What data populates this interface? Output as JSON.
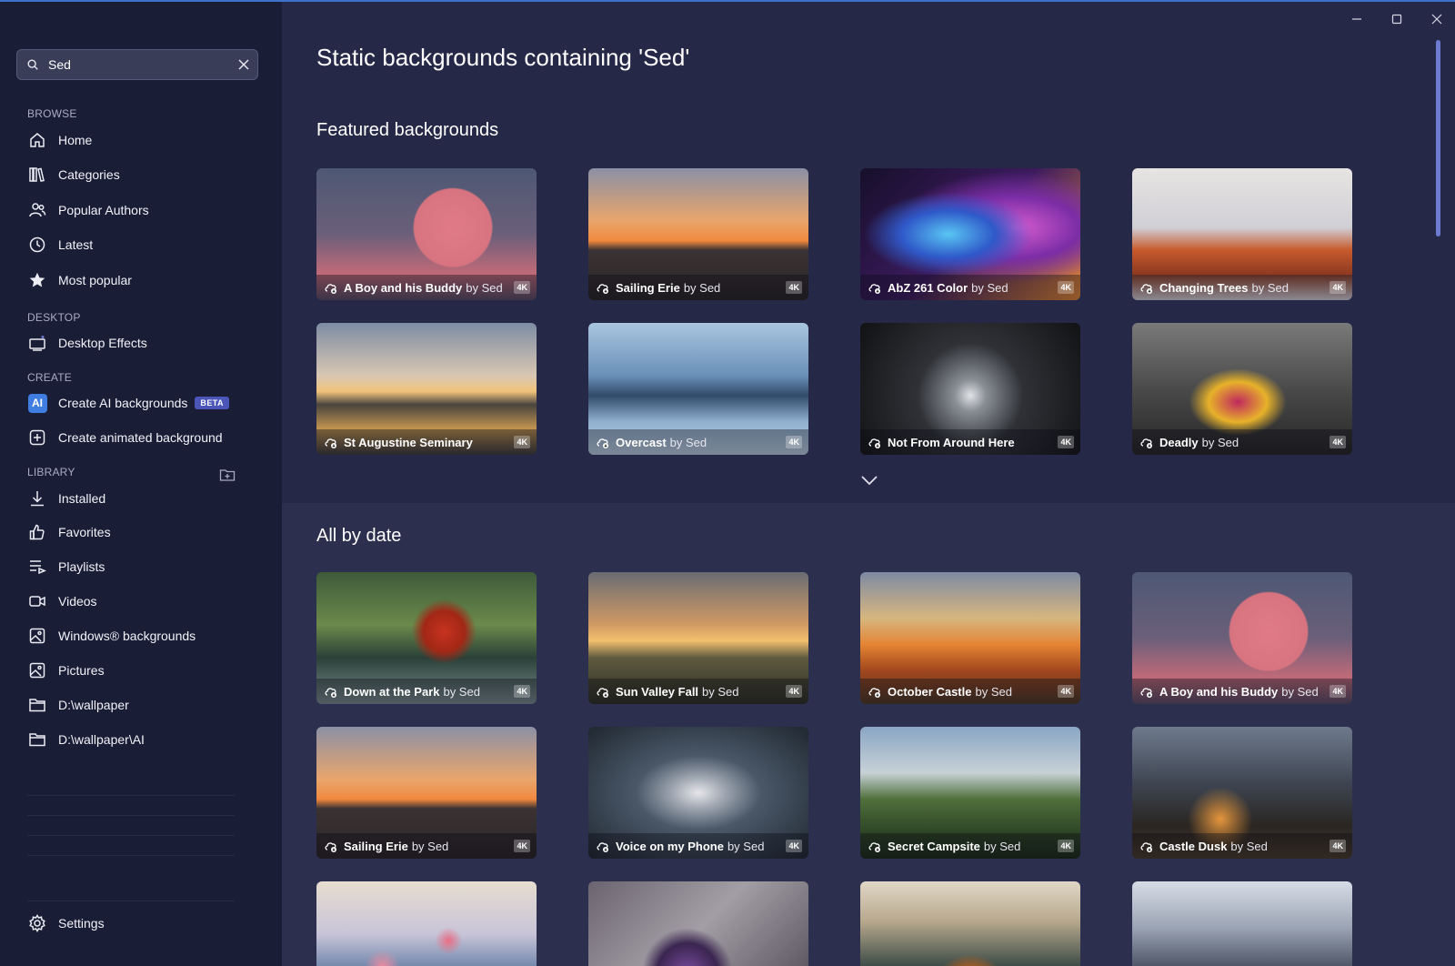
{
  "search": {
    "value": "Sed",
    "placeholder": ""
  },
  "sidebar": {
    "sections": {
      "browse": "BROWSE",
      "desktop": "DESKTOP",
      "create": "CREATE",
      "library": "LIBRARY"
    },
    "browse_items": [
      {
        "label": "Home",
        "icon": "home-icon"
      },
      {
        "label": "Categories",
        "icon": "books-icon"
      },
      {
        "label": "Popular Authors",
        "icon": "people-icon"
      },
      {
        "label": "Latest",
        "icon": "clock-icon"
      },
      {
        "label": "Most popular",
        "icon": "star-icon"
      }
    ],
    "desktop_items": [
      {
        "label": "Desktop Effects",
        "icon": "desktop-effects-icon"
      }
    ],
    "create_items": [
      {
        "label": "Create AI backgrounds",
        "icon": "ai-icon",
        "icon_text": "AI",
        "badge": "BETA"
      },
      {
        "label": "Create animated background",
        "icon": "add-box-icon"
      }
    ],
    "library_items": [
      {
        "label": "Installed",
        "icon": "download-icon"
      },
      {
        "label": "Favorites",
        "icon": "thumbs-up-icon"
      },
      {
        "label": "Playlists",
        "icon": "playlist-icon"
      },
      {
        "label": "Videos",
        "icon": "video-icon"
      },
      {
        "label": "Windows® backgrounds",
        "icon": "image-icon"
      },
      {
        "label": "Pictures",
        "icon": "image-icon"
      },
      {
        "label": "D:\\wallpaper",
        "icon": "folder-icon"
      },
      {
        "label": "D:\\wallpaper\\AI",
        "icon": "folder-icon"
      }
    ],
    "settings_label": "Settings"
  },
  "main": {
    "page_title": "Static backgrounds containing 'Sed'",
    "featured_title": "Featured backgrounds",
    "all_title": "All by date",
    "featured": [
      {
        "title": "A Boy and his Buddy",
        "author": "by Sed",
        "badge": "4K",
        "thumb": "t-boy"
      },
      {
        "title": "Sailing Erie",
        "author": "by Sed",
        "badge": "4K",
        "thumb": "t-sail"
      },
      {
        "title": "AbZ 261 Color",
        "author": "by Sed",
        "badge": "4K",
        "thumb": "t-abz"
      },
      {
        "title": "Changing Trees",
        "author": "by Sed",
        "badge": "4K",
        "thumb": "t-trees"
      },
      {
        "title": "St Augustine Seminary",
        "author": "",
        "badge": "4K",
        "thumb": "t-aug"
      },
      {
        "title": "Overcast",
        "author": "by Sed",
        "badge": "4K",
        "thumb": "t-over"
      },
      {
        "title": "Not From Around Here",
        "author": "",
        "badge": "4K",
        "thumb": "t-notfrom"
      },
      {
        "title": "Deadly",
        "author": "by Sed",
        "badge": "4K",
        "thumb": "t-deadly"
      }
    ],
    "by_date": [
      {
        "title": "Down at the Park",
        "author": "by Sed",
        "badge": "4K",
        "thumb": "t-park"
      },
      {
        "title": "Sun Valley Fall",
        "author": "by Sed",
        "badge": "4K",
        "thumb": "t-sunvalley"
      },
      {
        "title": "October Castle",
        "author": "by Sed",
        "badge": "4K",
        "thumb": "t-october"
      },
      {
        "title": "A Boy and his Buddy",
        "author": "by Sed",
        "badge": "4K",
        "thumb": "t-boy"
      },
      {
        "title": "Sailing Erie",
        "author": "by Sed",
        "badge": "4K",
        "thumb": "t-sail"
      },
      {
        "title": "Voice on my Phone",
        "author": "by Sed",
        "badge": "4K",
        "thumb": "t-voice"
      },
      {
        "title": "Secret Campsite",
        "author": "by Sed",
        "badge": "4K",
        "thumb": "t-secret"
      },
      {
        "title": "Castle Dusk",
        "author": "by Sed",
        "badge": "4K",
        "thumb": "t-castle"
      }
    ],
    "by_date_partial": [
      {
        "thumb": "t-flowers"
      },
      {
        "thumb": "t-marble"
      },
      {
        "thumb": "t-cubes"
      },
      {
        "thumb": "t-gothic"
      }
    ]
  },
  "colors": {
    "background": "#262848",
    "sidebar": "#1a1d36",
    "accent": "#3f7de0",
    "beta_badge": "#4b56b8"
  }
}
